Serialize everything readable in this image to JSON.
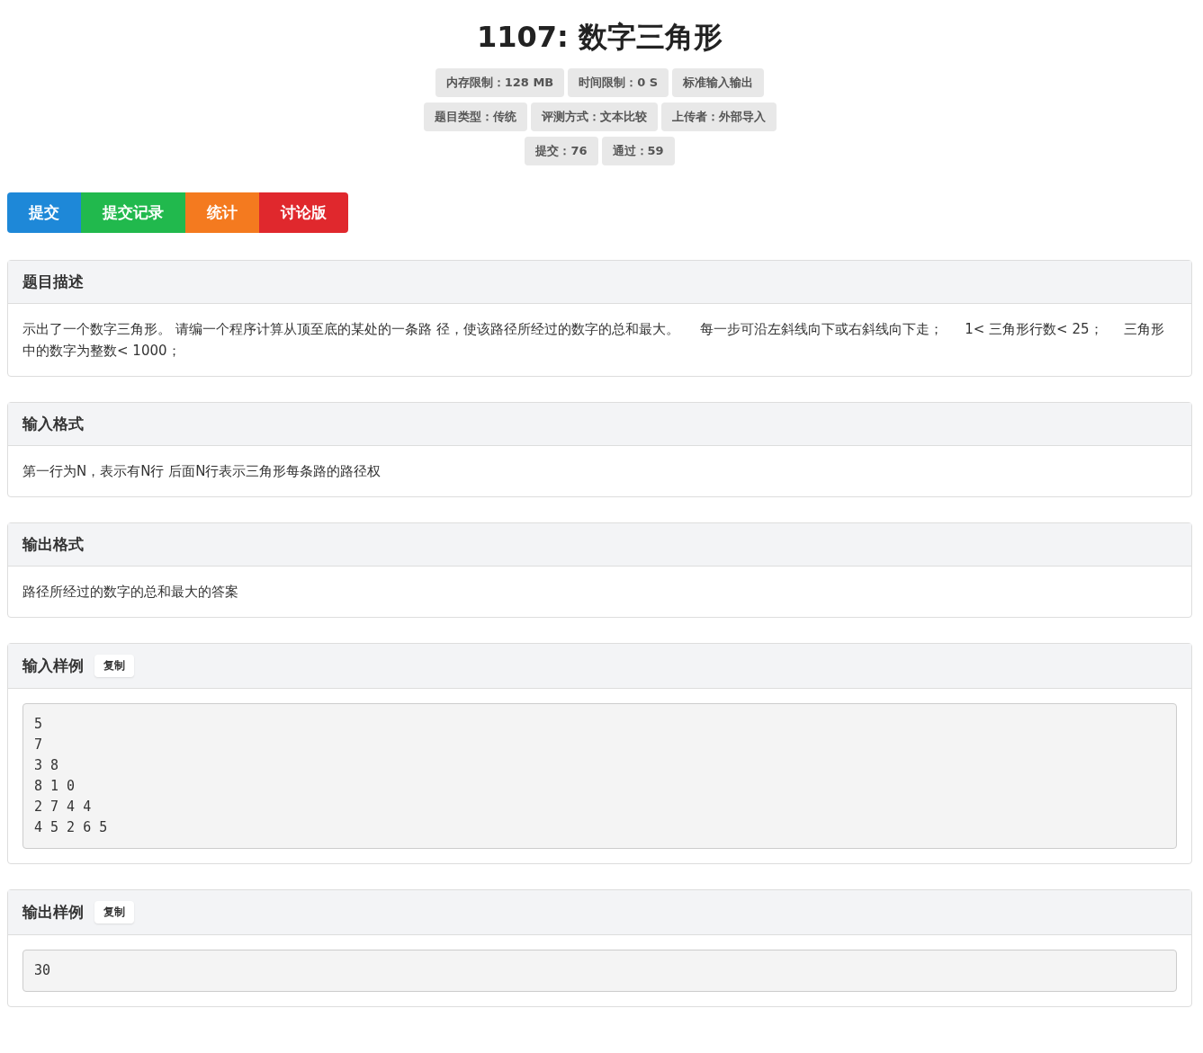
{
  "title": "1107: 数字三角形",
  "info_rows": [
    [
      "内存限制：128 MB",
      "时间限制：0 S",
      "标准输入输出"
    ],
    [
      "题目类型：传统",
      "评测方式：文本比较",
      "上传者：外部导入"
    ],
    [
      "提交：76",
      "通过：59"
    ]
  ],
  "actions": [
    {
      "label": "提交",
      "color": "#1e88d8"
    },
    {
      "label": "提交记录",
      "color": "#21b94d"
    },
    {
      "label": "统计",
      "color": "#f47a1f"
    },
    {
      "label": "讨论版",
      "color": "#e0282d"
    }
  ],
  "sections": [
    {
      "kind": "text",
      "title": "题目描述",
      "body": "示出了一个数字三角形。 请编一个程序计算从顶至底的某处的一条路 径，使该路径所经过的数字的总和最大。     每一步可沿左斜线向下或右斜线向下走；     1< 三角形行数< 25；     三角形中的数字为整数< 1000；"
    },
    {
      "kind": "text",
      "title": "输入格式",
      "body": "第一行为N，表示有N行 后面N行表示三角形每条路的路径权"
    },
    {
      "kind": "text",
      "title": "输出格式",
      "body": "路径所经过的数字的总和最大的答案"
    },
    {
      "kind": "sample",
      "title": "输入样例",
      "copy": "复制",
      "body": "5\n7\n3 8\n8 1 0\n2 7 4 4\n4 5 2 6 5"
    },
    {
      "kind": "sample",
      "title": "输出样例",
      "copy": "复制",
      "body": "30"
    }
  ]
}
